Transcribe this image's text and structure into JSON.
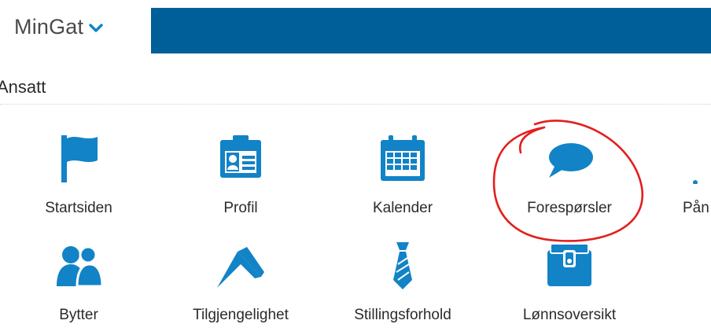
{
  "header": {
    "brand": "MinGat",
    "brand_icon": "chevron-down-icon"
  },
  "section": {
    "title": "Ansatt"
  },
  "colors": {
    "brand_blue": "#005e99",
    "icon_blue": "#1283c6",
    "annotation_red": "#e31e1e"
  },
  "tiles": [
    {
      "label": "Startsiden",
      "icon": "flag-icon"
    },
    {
      "label": "Profil",
      "icon": "id-card-icon"
    },
    {
      "label": "Kalender",
      "icon": "calendar-icon"
    },
    {
      "label": "Forespørsler",
      "icon": "speech-bubble-icon"
    },
    {
      "label": "Pån",
      "icon": "partial-icon"
    },
    {
      "label": "Bytter",
      "icon": "users-icon"
    },
    {
      "label": "Tilgjengelighet",
      "icon": "checkmark-flag-icon"
    },
    {
      "label": "Stillingsforhold",
      "icon": "tie-icon"
    },
    {
      "label": "Lønnsoversikt",
      "icon": "wallet-icon"
    }
  ]
}
